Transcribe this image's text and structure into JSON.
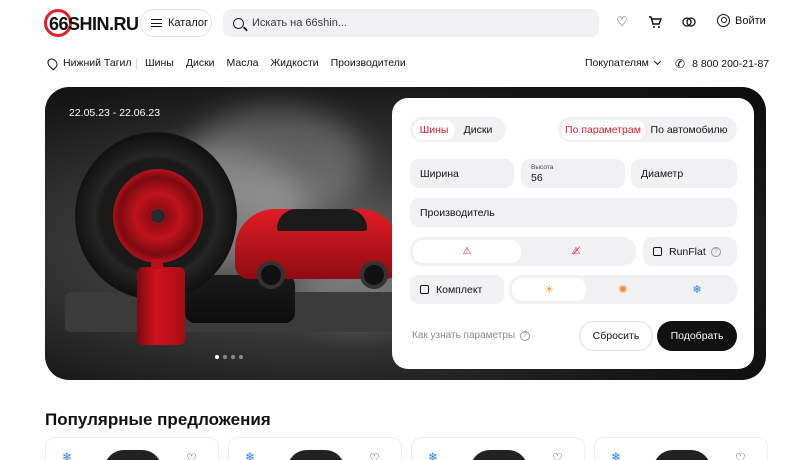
{
  "header": {
    "logo_text": "66SHIN.RU",
    "catalog_label": "Каталог",
    "search_placeholder": "Искать на 66shin...",
    "icons": [
      "heart-icon",
      "cart-icon",
      "compare-icon",
      "user-icon"
    ],
    "login_label": "Войти"
  },
  "nav": {
    "city": "Нижний Тагил",
    "links": [
      "Шины",
      "Диски",
      "Масла",
      "Жидкости",
      "Производители"
    ],
    "buyers_label": "Покупателям",
    "phone": "8 800 200-21-87"
  },
  "hero": {
    "date_range": "22.05.23 - 22.06.23",
    "slides_total": 4,
    "slide_active": 1
  },
  "search_form": {
    "product_tabs": [
      "Шины",
      "Диски"
    ],
    "product_active": "Шины",
    "mode_tabs": [
      "По параметрам",
      "По автомобилю"
    ],
    "mode_active": "По параметрам",
    "width_label": "Ширина",
    "height_label": "Высота",
    "height_value": "56",
    "diameter_label": "Диаметр",
    "manufacturer_label": "Производитель",
    "runflat_label": "RunFlat",
    "kit_label": "Комплект",
    "help_link": "Как узнать параметры",
    "reset_label": "Сбросить",
    "submit_label": "Подобрать",
    "colors": {
      "accent": "#e2202a",
      "dark": "#111111",
      "field_bg": "#f1f1f4"
    }
  },
  "popular": {
    "title": "Популярные предложения"
  }
}
